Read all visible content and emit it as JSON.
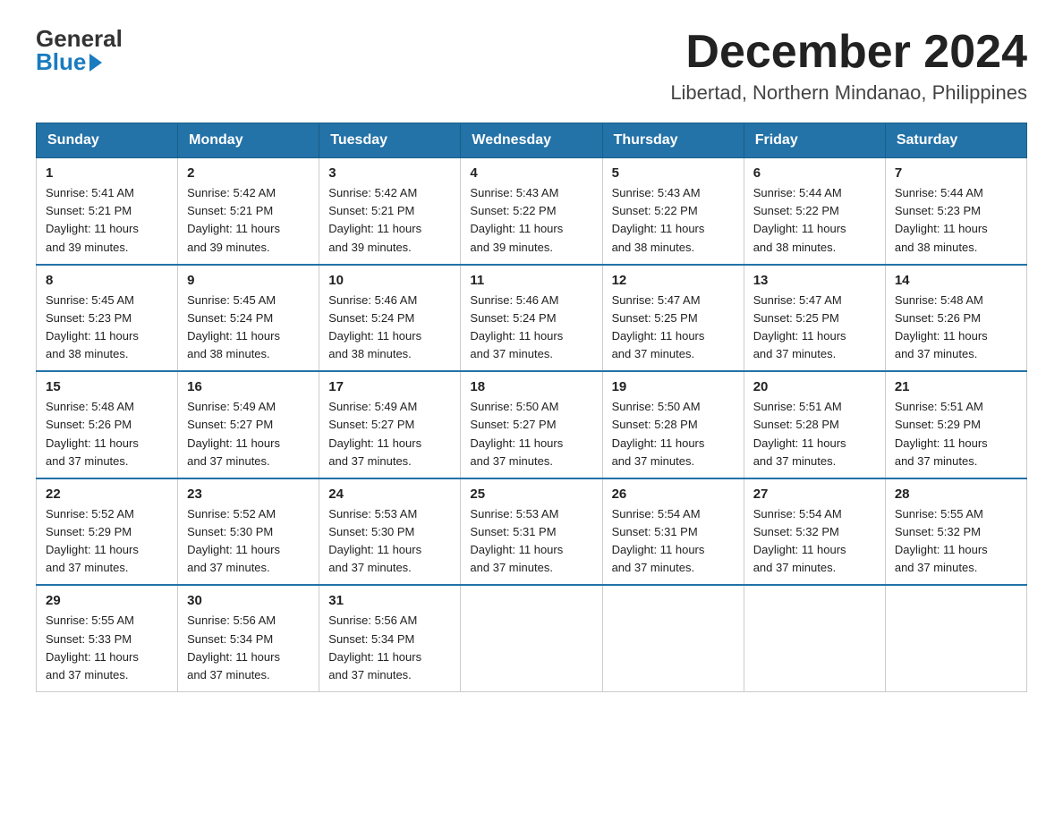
{
  "logo": {
    "general": "General",
    "blue": "Blue"
  },
  "title": "December 2024",
  "subtitle": "Libertad, Northern Mindanao, Philippines",
  "headers": [
    "Sunday",
    "Monday",
    "Tuesday",
    "Wednesday",
    "Thursday",
    "Friday",
    "Saturday"
  ],
  "weeks": [
    [
      {
        "day": "1",
        "sunrise": "5:41 AM",
        "sunset": "5:21 PM",
        "daylight": "11 hours and 39 minutes."
      },
      {
        "day": "2",
        "sunrise": "5:42 AM",
        "sunset": "5:21 PM",
        "daylight": "11 hours and 39 minutes."
      },
      {
        "day": "3",
        "sunrise": "5:42 AM",
        "sunset": "5:21 PM",
        "daylight": "11 hours and 39 minutes."
      },
      {
        "day": "4",
        "sunrise": "5:43 AM",
        "sunset": "5:22 PM",
        "daylight": "11 hours and 39 minutes."
      },
      {
        "day": "5",
        "sunrise": "5:43 AM",
        "sunset": "5:22 PM",
        "daylight": "11 hours and 38 minutes."
      },
      {
        "day": "6",
        "sunrise": "5:44 AM",
        "sunset": "5:22 PM",
        "daylight": "11 hours and 38 minutes."
      },
      {
        "day": "7",
        "sunrise": "5:44 AM",
        "sunset": "5:23 PM",
        "daylight": "11 hours and 38 minutes."
      }
    ],
    [
      {
        "day": "8",
        "sunrise": "5:45 AM",
        "sunset": "5:23 PM",
        "daylight": "11 hours and 38 minutes."
      },
      {
        "day": "9",
        "sunrise": "5:45 AM",
        "sunset": "5:24 PM",
        "daylight": "11 hours and 38 minutes."
      },
      {
        "day": "10",
        "sunrise": "5:46 AM",
        "sunset": "5:24 PM",
        "daylight": "11 hours and 38 minutes."
      },
      {
        "day": "11",
        "sunrise": "5:46 AM",
        "sunset": "5:24 PM",
        "daylight": "11 hours and 37 minutes."
      },
      {
        "day": "12",
        "sunrise": "5:47 AM",
        "sunset": "5:25 PM",
        "daylight": "11 hours and 37 minutes."
      },
      {
        "day": "13",
        "sunrise": "5:47 AM",
        "sunset": "5:25 PM",
        "daylight": "11 hours and 37 minutes."
      },
      {
        "day": "14",
        "sunrise": "5:48 AM",
        "sunset": "5:26 PM",
        "daylight": "11 hours and 37 minutes."
      }
    ],
    [
      {
        "day": "15",
        "sunrise": "5:48 AM",
        "sunset": "5:26 PM",
        "daylight": "11 hours and 37 minutes."
      },
      {
        "day": "16",
        "sunrise": "5:49 AM",
        "sunset": "5:27 PM",
        "daylight": "11 hours and 37 minutes."
      },
      {
        "day": "17",
        "sunrise": "5:49 AM",
        "sunset": "5:27 PM",
        "daylight": "11 hours and 37 minutes."
      },
      {
        "day": "18",
        "sunrise": "5:50 AM",
        "sunset": "5:27 PM",
        "daylight": "11 hours and 37 minutes."
      },
      {
        "day": "19",
        "sunrise": "5:50 AM",
        "sunset": "5:28 PM",
        "daylight": "11 hours and 37 minutes."
      },
      {
        "day": "20",
        "sunrise": "5:51 AM",
        "sunset": "5:28 PM",
        "daylight": "11 hours and 37 minutes."
      },
      {
        "day": "21",
        "sunrise": "5:51 AM",
        "sunset": "5:29 PM",
        "daylight": "11 hours and 37 minutes."
      }
    ],
    [
      {
        "day": "22",
        "sunrise": "5:52 AM",
        "sunset": "5:29 PM",
        "daylight": "11 hours and 37 minutes."
      },
      {
        "day": "23",
        "sunrise": "5:52 AM",
        "sunset": "5:30 PM",
        "daylight": "11 hours and 37 minutes."
      },
      {
        "day": "24",
        "sunrise": "5:53 AM",
        "sunset": "5:30 PM",
        "daylight": "11 hours and 37 minutes."
      },
      {
        "day": "25",
        "sunrise": "5:53 AM",
        "sunset": "5:31 PM",
        "daylight": "11 hours and 37 minutes."
      },
      {
        "day": "26",
        "sunrise": "5:54 AM",
        "sunset": "5:31 PM",
        "daylight": "11 hours and 37 minutes."
      },
      {
        "day": "27",
        "sunrise": "5:54 AM",
        "sunset": "5:32 PM",
        "daylight": "11 hours and 37 minutes."
      },
      {
        "day": "28",
        "sunrise": "5:55 AM",
        "sunset": "5:32 PM",
        "daylight": "11 hours and 37 minutes."
      }
    ],
    [
      {
        "day": "29",
        "sunrise": "5:55 AM",
        "sunset": "5:33 PM",
        "daylight": "11 hours and 37 minutes."
      },
      {
        "day": "30",
        "sunrise": "5:56 AM",
        "sunset": "5:34 PM",
        "daylight": "11 hours and 37 minutes."
      },
      {
        "day": "31",
        "sunrise": "5:56 AM",
        "sunset": "5:34 PM",
        "daylight": "11 hours and 37 minutes."
      },
      null,
      null,
      null,
      null
    ]
  ],
  "labels": {
    "sunrise_prefix": "Sunrise: ",
    "sunset_prefix": "Sunset: ",
    "daylight_prefix": "Daylight: "
  }
}
